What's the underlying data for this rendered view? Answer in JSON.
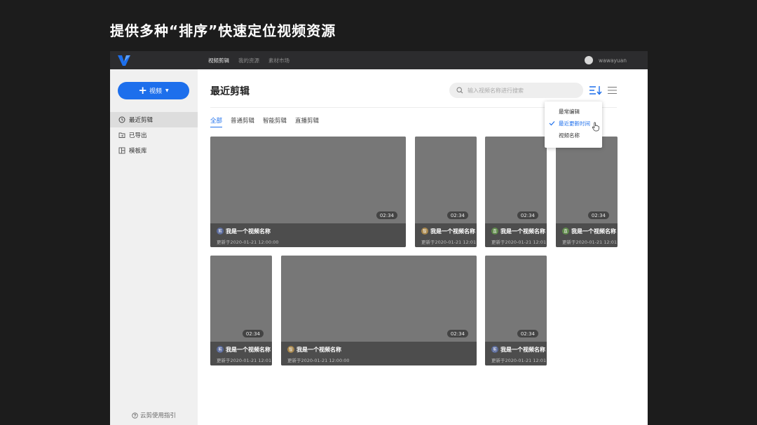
{
  "slide_title": "提供多种“排序”快速定位视频资源",
  "app": {
    "nav": [
      "视频剪辑",
      "我的资源",
      "素材市场"
    ],
    "user_name": "wawayuan",
    "sidebar": {
      "new_button": {
        "plus": "+",
        "label": "视频"
      },
      "items": [
        {
          "label": "最近剪辑",
          "icon": "clock-icon"
        },
        {
          "label": "已导出",
          "icon": "folder-export-icon"
        },
        {
          "label": "模板库",
          "icon": "template-icon"
        }
      ],
      "footer": "云剪使用指引"
    },
    "page_title": "最近剪辑",
    "search_placeholder": "输入视频名称进行搜索",
    "tabs": [
      "全部",
      "普通剪辑",
      "智能剪辑",
      "直播剪辑"
    ],
    "sort_menu": [
      "最常编辑",
      "最近更新时间",
      "视频名称"
    ],
    "cards": [
      {
        "duration": "02:34",
        "title": "我是一个视频名称",
        "date": "更新于2020-01-21 12:00:00",
        "badge": "剪",
        "badge_color": "#5b6b9c"
      },
      {
        "duration": "02:34",
        "title": "我是一个视频名称",
        "date": "更新于2020-01-21 12:01",
        "badge": "智",
        "badge_color": "#a8874c"
      },
      {
        "duration": "02:34",
        "title": "我是一个视频名称",
        "date": "更新于2020-01-21 12:01",
        "badge": "直",
        "badge_color": "#5f8a4a"
      },
      {
        "duration": "02:34",
        "title": "我是一个视频名称",
        "date": "更新于2020-01-21 12:01",
        "badge": "直",
        "badge_color": "#5f8a4a"
      },
      {
        "duration": "02:34",
        "title": "我是一个视频名称",
        "date": "更新于2020-01-21 12:01",
        "badge": "剪",
        "badge_color": "#5b6b9c"
      },
      {
        "duration": "02:34",
        "title": "我是一个视频名称",
        "date": "更新于2020-01-21 12:00:00",
        "badge": "智",
        "badge_color": "#a8874c"
      },
      {
        "duration": "02:34",
        "title": "我是一个视频名称",
        "date": "更新于2020-01-21 12:01",
        "badge": "剪",
        "badge_color": "#5b6b9c"
      }
    ]
  },
  "colors": {
    "accent": "#1d6fec",
    "topbar": "#2c2c2e",
    "card": "#777777",
    "card_info": "#4d4d4d"
  }
}
